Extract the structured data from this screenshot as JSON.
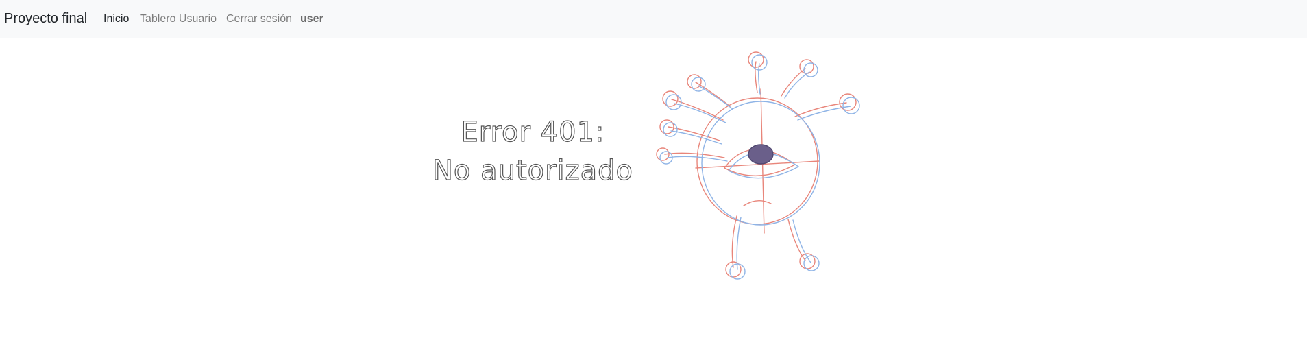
{
  "navbar": {
    "brand": "Proyecto final",
    "links": [
      {
        "label": "Inicio",
        "active": true
      },
      {
        "label": "Tablero Usuario",
        "active": false
      },
      {
        "label": "Cerrar sesión",
        "active": false
      }
    ],
    "user": "user"
  },
  "error": {
    "line1": "Error 401:",
    "line2": "No autorizado"
  },
  "illustration": {
    "icon": "one-eyed-monster-sketch-icon",
    "colors": {
      "red": "#e8857a",
      "blue": "#8fb4e6",
      "pupil": "#6a5f8a"
    }
  }
}
